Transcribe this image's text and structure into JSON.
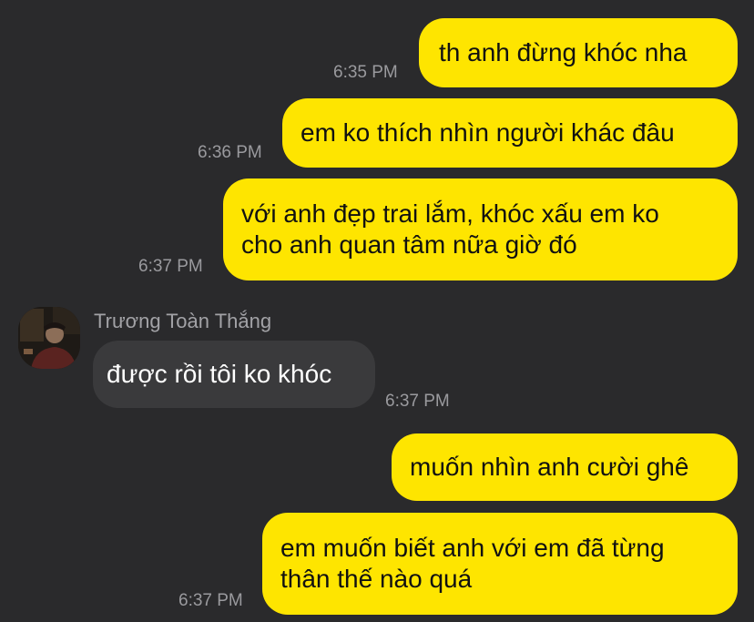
{
  "messages": [
    {
      "dir": "out",
      "text": "th anh đừng khóc nha",
      "time": "6:35 PM"
    },
    {
      "dir": "out",
      "text": "em ko thích nhìn người khác đâu",
      "time": "6:36 PM"
    },
    {
      "dir": "out",
      "line1": "với anh đẹp trai lắm, khóc xấu em ko",
      "line2": "cho anh quan tâm nữa giờ đó",
      "time": "6:37 PM"
    },
    {
      "dir": "in",
      "sender": "Trương Toàn Thắng",
      "text": "được rồi tôi ko khóc",
      "time": "6:37 PM"
    },
    {
      "dir": "out",
      "text": "muốn nhìn anh cười ghê"
    },
    {
      "dir": "out",
      "line1": "em muốn biết anh với em đã từng",
      "line2": "thân thế nào quá",
      "time": "6:37 PM"
    }
  ],
  "colors": {
    "background": "#2a2a2c",
    "outgoing_bubble": "#fee500",
    "incoming_bubble": "#3a3a3c",
    "timestamp": "#9a9a9e"
  }
}
